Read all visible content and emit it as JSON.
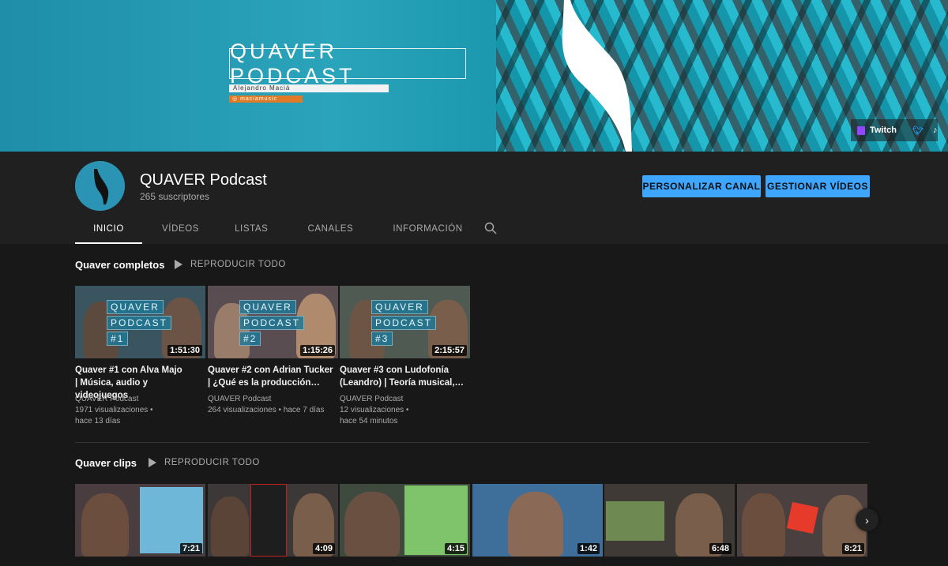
{
  "banner": {
    "title": "QUAVER PODCAST",
    "subtitle": "Alejandro Maciá",
    "twitch_handle": "maciamusic",
    "links": {
      "twitch_label": "Twitch"
    }
  },
  "channel": {
    "name": "QUAVER Podcast",
    "subscribers": "265 suscriptores",
    "customize_button": "PERSONALIZAR CANAL",
    "manage_button": "GESTIONAR VÍDEOS"
  },
  "tabs": [
    {
      "label": "INICIO",
      "active": true
    },
    {
      "label": "VÍDEOS",
      "active": false
    },
    {
      "label": "LISTAS",
      "active": false
    },
    {
      "label": "CANALES",
      "active": false
    },
    {
      "label": "INFORMACIÓN",
      "active": false
    }
  ],
  "shelves": [
    {
      "title": "Quaver completos",
      "play_all": "REPRODUCIR TODO",
      "videos": [
        {
          "thumb_number": "#1",
          "duration": "1:51:30",
          "title_line1": "Quaver #1 con Alva Majo",
          "title_line2": "| Música, audio y videojuegos",
          "channel": "QUAVER Podcast",
          "views": "1971 visualizaciones •",
          "age": "hace 13 días"
        },
        {
          "thumb_number": "#2",
          "duration": "1:15:26",
          "title_line1": "Quaver #2 con Adrian Tucker",
          "title_line2": "| ¿Qué es la producción…",
          "channel": "QUAVER Podcast",
          "views": "264 visualizaciones • hace 7 días",
          "age": ""
        },
        {
          "thumb_number": "#3",
          "duration": "2:15:57",
          "title_line1": "Quaver #3 con Ludofonía",
          "title_line2": "(Leandro) | Teoría musical,…",
          "channel": "QUAVER Podcast",
          "views": "12 visualizaciones •",
          "age": "hace 54 minutos"
        }
      ]
    },
    {
      "title": "Quaver clips",
      "play_all": "REPRODUCIR TODO",
      "videos": [
        {
          "duration": "7:21"
        },
        {
          "duration": "4:09"
        },
        {
          "duration": "4:15"
        },
        {
          "duration": "1:42"
        },
        {
          "duration": "6:48"
        },
        {
          "duration": "8:21"
        }
      ]
    }
  ],
  "thumb_overlay": {
    "line1": "QUAVER",
    "line2": "PODCAST"
  },
  "colors": {
    "accent": "#3ea6ff",
    "banner_teal": "#1f8ea8",
    "background": "#181818",
    "header_bg": "#202020"
  },
  "icons": [
    "search-icon",
    "twitch-icon",
    "twitter-icon",
    "tiktok-icon",
    "play-icon",
    "chevron-right-icon"
  ]
}
